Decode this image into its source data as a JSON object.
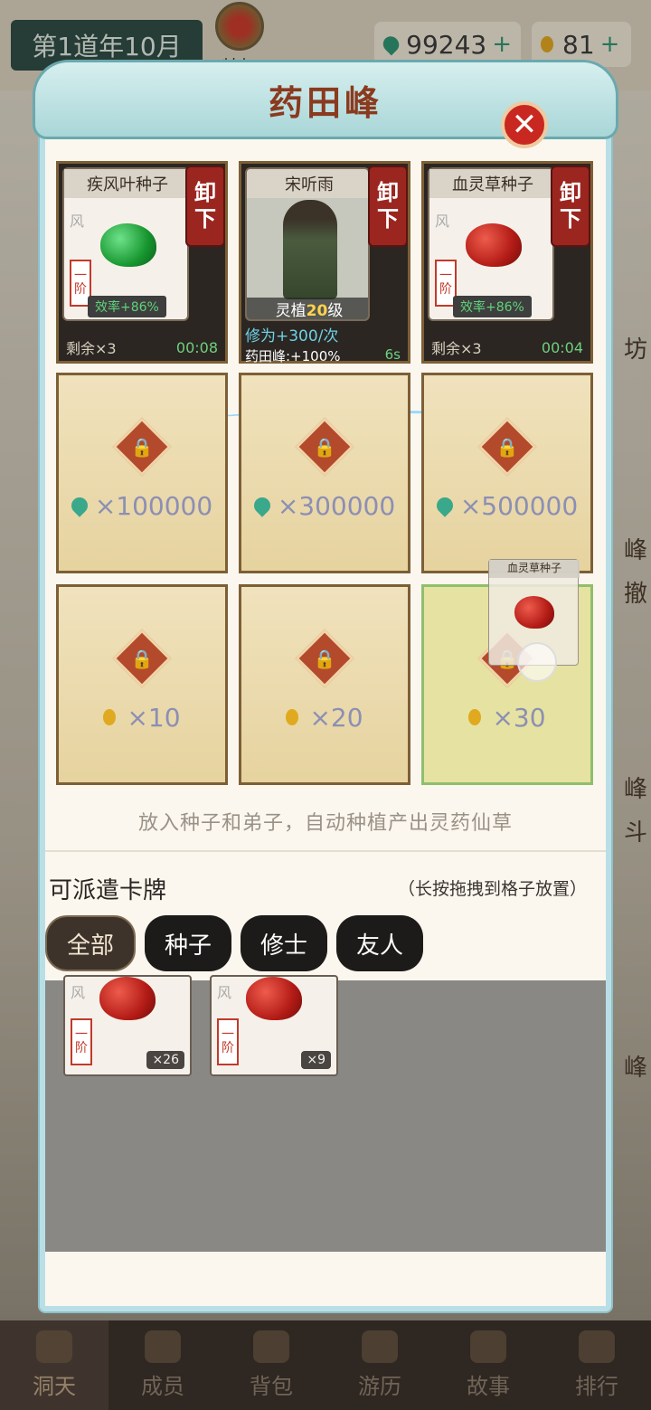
{
  "topbar": {
    "date": "第1道年10月",
    "privilege_label": "特权",
    "spirit_stones": "99243",
    "spirit_stones_plus": "+",
    "drops": "81",
    "drops_plus": "+"
  },
  "background_side_labels": [
    "坊",
    "峰",
    "撤",
    "峰",
    "斗",
    "峰"
  ],
  "panel": {
    "title": "药田峰",
    "close_icon": "close-x"
  },
  "slots_filled": [
    {
      "card_title": "疾风叶种子",
      "grade": "一阶",
      "grade_mark": "风",
      "efficiency": "效率+86%",
      "unload": [
        "卸",
        "下"
      ],
      "remaining": "剩余×3",
      "timer": "00:08",
      "seed_color": "green"
    },
    {
      "card_title": "宋听雨",
      "level_prefix": "灵植",
      "level_value": "20",
      "level_suffix": "级",
      "unload": [
        "卸",
        "下"
      ],
      "cultivation": "修为+300/次",
      "peak_bonus": "药田峰:+100%",
      "timer": "6s"
    },
    {
      "card_title": "血灵草种子",
      "grade": "一阶",
      "grade_mark": "风",
      "efficiency": "效率+86%",
      "unload": [
        "卸",
        "下"
      ],
      "remaining": "剩余×3",
      "timer": "00:04",
      "seed_color": "red"
    }
  ],
  "slots_locked": [
    {
      "cost": "×100000",
      "currency": "spirit-stone"
    },
    {
      "cost": "×300000",
      "currency": "spirit-stone"
    },
    {
      "cost": "×500000",
      "currency": "spirit-stone"
    },
    {
      "cost": "×10",
      "currency": "drop"
    },
    {
      "cost": "×20",
      "currency": "drop"
    },
    {
      "cost": "×30",
      "currency": "drop"
    }
  ],
  "drag_preview": {
    "title": "血灵草种子"
  },
  "hint": "放入种子和弟子，自动种植产出灵药仙草",
  "dispatch": {
    "title": "可派遣卡牌",
    "tip": "（长按拖拽到格子放置）",
    "tabs": [
      "全部",
      "种子",
      "修士",
      "友人"
    ]
  },
  "deck": [
    {
      "grade": "一阶",
      "grade_mark": "风",
      "count": "×26"
    },
    {
      "grade": "一阶",
      "grade_mark": "风",
      "count": "×9"
    }
  ],
  "bottom_nav": [
    "洞天",
    "成员",
    "背包",
    "游历",
    "故事",
    "排行"
  ],
  "colors": {
    "accent_red": "#9b2620",
    "panel_border": "#b9dfe6",
    "title_color": "#8a3a1e",
    "efficiency_green": "#6ed17f"
  }
}
